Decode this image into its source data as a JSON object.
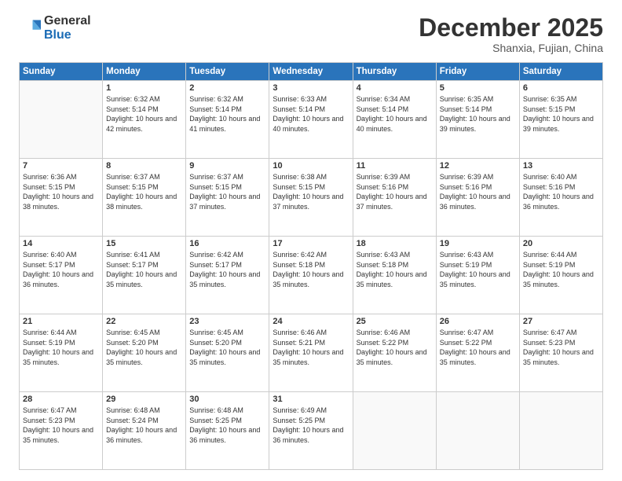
{
  "header": {
    "logo_general": "General",
    "logo_blue": "Blue",
    "month_title": "December 2025",
    "subtitle": "Shanxia, Fujian, China"
  },
  "weekdays": [
    "Sunday",
    "Monday",
    "Tuesday",
    "Wednesday",
    "Thursday",
    "Friday",
    "Saturday"
  ],
  "days": [
    {
      "week": 1,
      "cells": [
        {
          "day": "",
          "sunrise": "",
          "sunset": "",
          "daylight": ""
        },
        {
          "day": "1",
          "sunrise": "Sunrise: 6:32 AM",
          "sunset": "Sunset: 5:14 PM",
          "daylight": "Daylight: 10 hours and 42 minutes."
        },
        {
          "day": "2",
          "sunrise": "Sunrise: 6:32 AM",
          "sunset": "Sunset: 5:14 PM",
          "daylight": "Daylight: 10 hours and 41 minutes."
        },
        {
          "day": "3",
          "sunrise": "Sunrise: 6:33 AM",
          "sunset": "Sunset: 5:14 PM",
          "daylight": "Daylight: 10 hours and 40 minutes."
        },
        {
          "day": "4",
          "sunrise": "Sunrise: 6:34 AM",
          "sunset": "Sunset: 5:14 PM",
          "daylight": "Daylight: 10 hours and 40 minutes."
        },
        {
          "day": "5",
          "sunrise": "Sunrise: 6:35 AM",
          "sunset": "Sunset: 5:14 PM",
          "daylight": "Daylight: 10 hours and 39 minutes."
        },
        {
          "day": "6",
          "sunrise": "Sunrise: 6:35 AM",
          "sunset": "Sunset: 5:15 PM",
          "daylight": "Daylight: 10 hours and 39 minutes."
        }
      ]
    },
    {
      "week": 2,
      "cells": [
        {
          "day": "7",
          "sunrise": "Sunrise: 6:36 AM",
          "sunset": "Sunset: 5:15 PM",
          "daylight": "Daylight: 10 hours and 38 minutes."
        },
        {
          "day": "8",
          "sunrise": "Sunrise: 6:37 AM",
          "sunset": "Sunset: 5:15 PM",
          "daylight": "Daylight: 10 hours and 38 minutes."
        },
        {
          "day": "9",
          "sunrise": "Sunrise: 6:37 AM",
          "sunset": "Sunset: 5:15 PM",
          "daylight": "Daylight: 10 hours and 37 minutes."
        },
        {
          "day": "10",
          "sunrise": "Sunrise: 6:38 AM",
          "sunset": "Sunset: 5:15 PM",
          "daylight": "Daylight: 10 hours and 37 minutes."
        },
        {
          "day": "11",
          "sunrise": "Sunrise: 6:39 AM",
          "sunset": "Sunset: 5:16 PM",
          "daylight": "Daylight: 10 hours and 37 minutes."
        },
        {
          "day": "12",
          "sunrise": "Sunrise: 6:39 AM",
          "sunset": "Sunset: 5:16 PM",
          "daylight": "Daylight: 10 hours and 36 minutes."
        },
        {
          "day": "13",
          "sunrise": "Sunrise: 6:40 AM",
          "sunset": "Sunset: 5:16 PM",
          "daylight": "Daylight: 10 hours and 36 minutes."
        }
      ]
    },
    {
      "week": 3,
      "cells": [
        {
          "day": "14",
          "sunrise": "Sunrise: 6:40 AM",
          "sunset": "Sunset: 5:17 PM",
          "daylight": "Daylight: 10 hours and 36 minutes."
        },
        {
          "day": "15",
          "sunrise": "Sunrise: 6:41 AM",
          "sunset": "Sunset: 5:17 PM",
          "daylight": "Daylight: 10 hours and 35 minutes."
        },
        {
          "day": "16",
          "sunrise": "Sunrise: 6:42 AM",
          "sunset": "Sunset: 5:17 PM",
          "daylight": "Daylight: 10 hours and 35 minutes."
        },
        {
          "day": "17",
          "sunrise": "Sunrise: 6:42 AM",
          "sunset": "Sunset: 5:18 PM",
          "daylight": "Daylight: 10 hours and 35 minutes."
        },
        {
          "day": "18",
          "sunrise": "Sunrise: 6:43 AM",
          "sunset": "Sunset: 5:18 PM",
          "daylight": "Daylight: 10 hours and 35 minutes."
        },
        {
          "day": "19",
          "sunrise": "Sunrise: 6:43 AM",
          "sunset": "Sunset: 5:19 PM",
          "daylight": "Daylight: 10 hours and 35 minutes."
        },
        {
          "day": "20",
          "sunrise": "Sunrise: 6:44 AM",
          "sunset": "Sunset: 5:19 PM",
          "daylight": "Daylight: 10 hours and 35 minutes."
        }
      ]
    },
    {
      "week": 4,
      "cells": [
        {
          "day": "21",
          "sunrise": "Sunrise: 6:44 AM",
          "sunset": "Sunset: 5:19 PM",
          "daylight": "Daylight: 10 hours and 35 minutes."
        },
        {
          "day": "22",
          "sunrise": "Sunrise: 6:45 AM",
          "sunset": "Sunset: 5:20 PM",
          "daylight": "Daylight: 10 hours and 35 minutes."
        },
        {
          "day": "23",
          "sunrise": "Sunrise: 6:45 AM",
          "sunset": "Sunset: 5:20 PM",
          "daylight": "Daylight: 10 hours and 35 minutes."
        },
        {
          "day": "24",
          "sunrise": "Sunrise: 6:46 AM",
          "sunset": "Sunset: 5:21 PM",
          "daylight": "Daylight: 10 hours and 35 minutes."
        },
        {
          "day": "25",
          "sunrise": "Sunrise: 6:46 AM",
          "sunset": "Sunset: 5:22 PM",
          "daylight": "Daylight: 10 hours and 35 minutes."
        },
        {
          "day": "26",
          "sunrise": "Sunrise: 6:47 AM",
          "sunset": "Sunset: 5:22 PM",
          "daylight": "Daylight: 10 hours and 35 minutes."
        },
        {
          "day": "27",
          "sunrise": "Sunrise: 6:47 AM",
          "sunset": "Sunset: 5:23 PM",
          "daylight": "Daylight: 10 hours and 35 minutes."
        }
      ]
    },
    {
      "week": 5,
      "cells": [
        {
          "day": "28",
          "sunrise": "Sunrise: 6:47 AM",
          "sunset": "Sunset: 5:23 PM",
          "daylight": "Daylight: 10 hours and 35 minutes."
        },
        {
          "day": "29",
          "sunrise": "Sunrise: 6:48 AM",
          "sunset": "Sunset: 5:24 PM",
          "daylight": "Daylight: 10 hours and 36 minutes."
        },
        {
          "day": "30",
          "sunrise": "Sunrise: 6:48 AM",
          "sunset": "Sunset: 5:25 PM",
          "daylight": "Daylight: 10 hours and 36 minutes."
        },
        {
          "day": "31",
          "sunrise": "Sunrise: 6:49 AM",
          "sunset": "Sunset: 5:25 PM",
          "daylight": "Daylight: 10 hours and 36 minutes."
        },
        {
          "day": "",
          "sunrise": "",
          "sunset": "",
          "daylight": ""
        },
        {
          "day": "",
          "sunrise": "",
          "sunset": "",
          "daylight": ""
        },
        {
          "day": "",
          "sunrise": "",
          "sunset": "",
          "daylight": ""
        }
      ]
    }
  ]
}
